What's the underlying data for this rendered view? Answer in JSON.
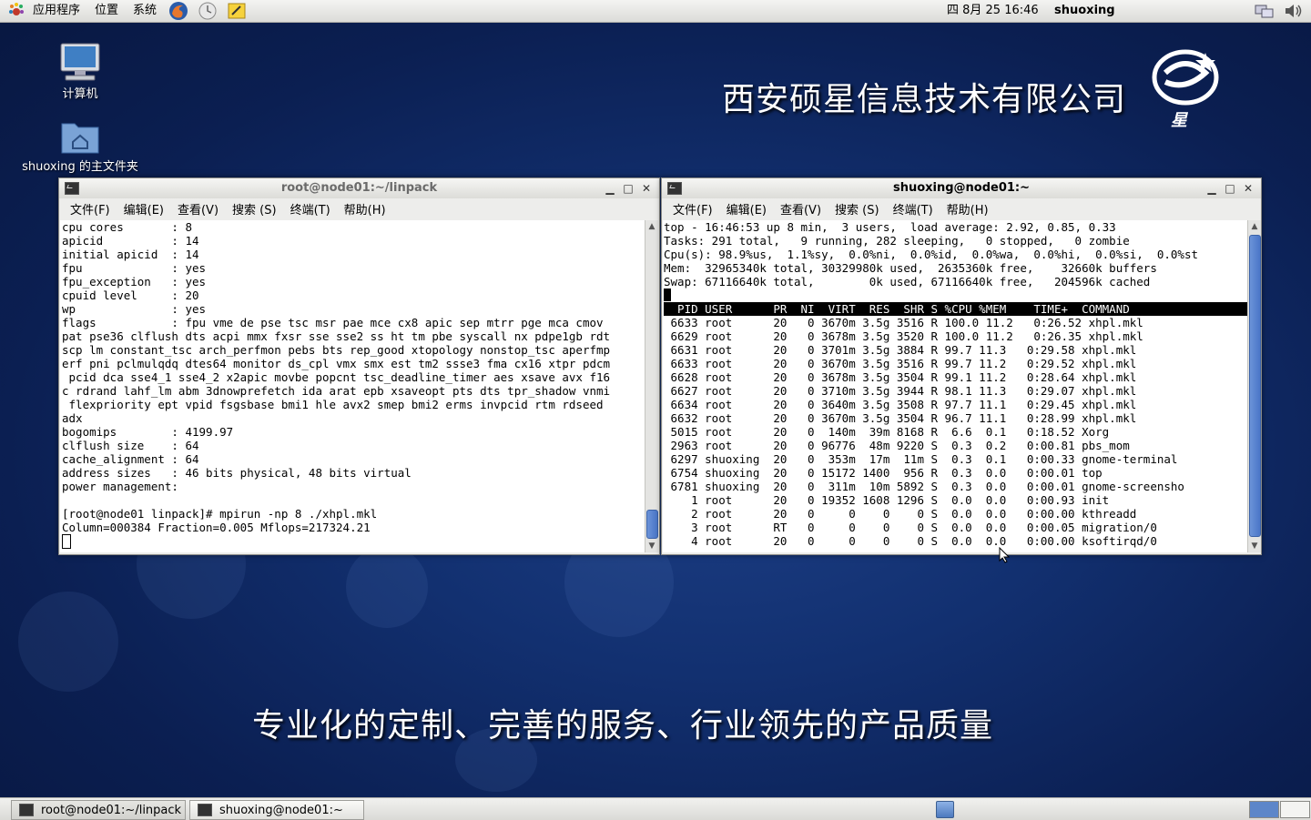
{
  "top_panel": {
    "menus": [
      "应用程序",
      "位置",
      "系统"
    ],
    "launchers": [
      "firefox-icon",
      "mail-icon",
      "notes-icon"
    ],
    "clock": "四 8月 25 16:46",
    "user": "shuoxing",
    "tray": [
      "network-icon",
      "volume-icon"
    ]
  },
  "desktop": {
    "icons": [
      {
        "label": "计算机",
        "icon": "computer-icon"
      },
      {
        "label": "shuoxing 的主文件夹",
        "icon": "home-folder-icon"
      }
    ],
    "company_name": "西安硕星信息技术有限公司",
    "logo_text": "星",
    "slogan": "专业化的定制、完善的服务、行业领先的产品质量"
  },
  "window_left": {
    "title": "root@node01:~/linpack",
    "menus": [
      "文件(F)",
      "编辑(E)",
      "查看(V)",
      "搜索 (S)",
      "终端(T)",
      "帮助(H)"
    ],
    "lines": [
      "cpu cores       : 8",
      "apicid          : 14",
      "initial apicid  : 14",
      "fpu             : yes",
      "fpu_exception   : yes",
      "cpuid level     : 20",
      "wp              : yes",
      "flags           : fpu vme de pse tsc msr pae mce cx8 apic sep mtrr pge mca cmov",
      "pat pse36 clflush dts acpi mmx fxsr sse sse2 ss ht tm pbe syscall nx pdpe1gb rdt",
      "scp lm constant_tsc arch_perfmon pebs bts rep_good xtopology nonstop_tsc aperfmp",
      "erf pni pclmulqdq dtes64 monitor ds_cpl vmx smx est tm2 ssse3 fma cx16 xtpr pdcm",
      " pcid dca sse4_1 sse4_2 x2apic movbe popcnt tsc_deadline_timer aes xsave avx f16",
      "c rdrand lahf_lm abm 3dnowprefetch ida arat epb xsaveopt pts dts tpr_shadow vnmi",
      " flexpriority ept vpid fsgsbase bmi1 hle avx2 smep bmi2 erms invpcid rtm rdseed",
      "adx",
      "bogomips        : 4199.97",
      "clflush size    : 64",
      "cache_alignment : 64",
      "address sizes   : 46 bits physical, 48 bits virtual",
      "power management:",
      "",
      "[root@node01 linpack]# mpirun -np 8 ./xhpl.mkl",
      "Column=000384 Fraction=0.005 Mflops=217324.21"
    ]
  },
  "window_right": {
    "title": "shuoxing@node01:~",
    "menus": [
      "文件(F)",
      "编辑(E)",
      "查看(V)",
      "搜索 (S)",
      "终端(T)",
      "帮助(H)"
    ],
    "summary": [
      "top - 16:46:53 up 8 min,  3 users,  load average: 2.92, 0.85, 0.33",
      "Tasks: 291 total,   9 running, 282 sleeping,   0 stopped,   0 zombie",
      "Cpu(s): 98.9%us,  1.1%sy,  0.0%ni,  0.0%id,  0.0%wa,  0.0%hi,  0.0%si,  0.0%st",
      "Mem:  32965340k total, 30329980k used,  2635360k free,    32660k buffers",
      "Swap: 67116640k total,        0k used, 67116640k free,   204596k cached"
    ],
    "header": "  PID USER      PR  NI  VIRT  RES  SHR S %CPU %MEM    TIME+  COMMAND",
    "processes": [
      " 6633 root      20   0 3670m 3.5g 3516 R 100.0 11.2   0:26.52 xhpl.mkl",
      " 6629 root      20   0 3678m 3.5g 3520 R 100.0 11.2   0:26.35 xhpl.mkl",
      " 6631 root      20   0 3701m 3.5g 3884 R 99.7 11.3   0:29.58 xhpl.mkl",
      " 6633 root      20   0 3670m 3.5g 3516 R 99.7 11.2   0:29.52 xhpl.mkl",
      " 6628 root      20   0 3678m 3.5g 3504 R 99.1 11.2   0:28.64 xhpl.mkl",
      " 6627 root      20   0 3710m 3.5g 3944 R 98.1 11.3   0:29.07 xhpl.mkl",
      " 6634 root      20   0 3640m 3.5g 3508 R 97.7 11.1   0:29.45 xhpl.mkl",
      " 6632 root      20   0 3670m 3.5g 3504 R 96.7 11.1   0:28.99 xhpl.mkl",
      " 5015 root      20   0  140m  39m 8168 R  6.6  0.1   0:18.52 Xorg",
      " 2963 root      20   0 96776  48m 9220 S  0.3  0.2   0:00.81 pbs_mom",
      " 6297 shuoxing  20   0  353m  17m  11m S  0.3  0.1   0:00.33 gnome-terminal",
      " 6754 shuoxing  20   0 15172 1400  956 R  0.3  0.0   0:00.01 top",
      " 6781 shuoxing  20   0  311m  10m 5892 S  0.3  0.0   0:00.01 gnome-screensho",
      "    1 root      20   0 19352 1608 1296 S  0.0  0.0   0:00.93 init",
      "    2 root      20   0     0    0    0 S  0.0  0.0   0:00.00 kthreadd",
      "    3 root      RT   0     0    0    0 S  0.0  0.0   0:00.05 migration/0",
      "    4 root      20   0     0    0    0 S  0.0  0.0   0:00.00 ksoftirqd/0"
    ]
  },
  "bottom_panel": {
    "tasks": [
      "root@node01:~/linpack",
      "shuoxing@node01:~"
    ]
  }
}
